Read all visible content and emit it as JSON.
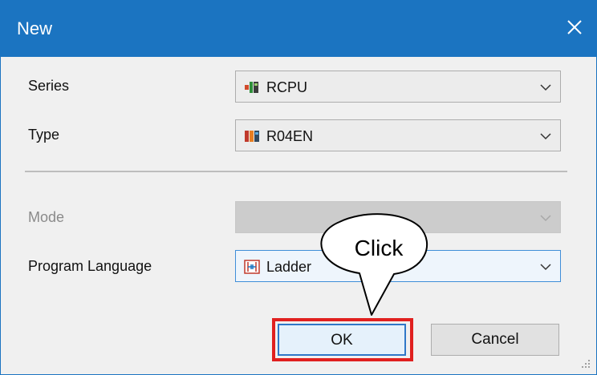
{
  "window": {
    "title": "New",
    "close_icon": "close-icon"
  },
  "fields": {
    "series": {
      "label": "Series",
      "value": "RCPU",
      "icon": "cpu-module-icon"
    },
    "type": {
      "label": "Type",
      "value": "R04EN",
      "icon": "module-type-icon"
    },
    "mode": {
      "label": "Mode",
      "value": "",
      "enabled": false
    },
    "program_language": {
      "label": "Program Language",
      "value": "Ladder",
      "icon": "ladder-icon"
    }
  },
  "buttons": {
    "ok": "OK",
    "cancel": "Cancel"
  },
  "annotation": {
    "text": "Click",
    "highlight_color": "#e0201f"
  },
  "colors": {
    "titlebar": "#1b74c1",
    "dialog_bg": "#f0f0f0",
    "focus_border": "#3f8ed8"
  }
}
